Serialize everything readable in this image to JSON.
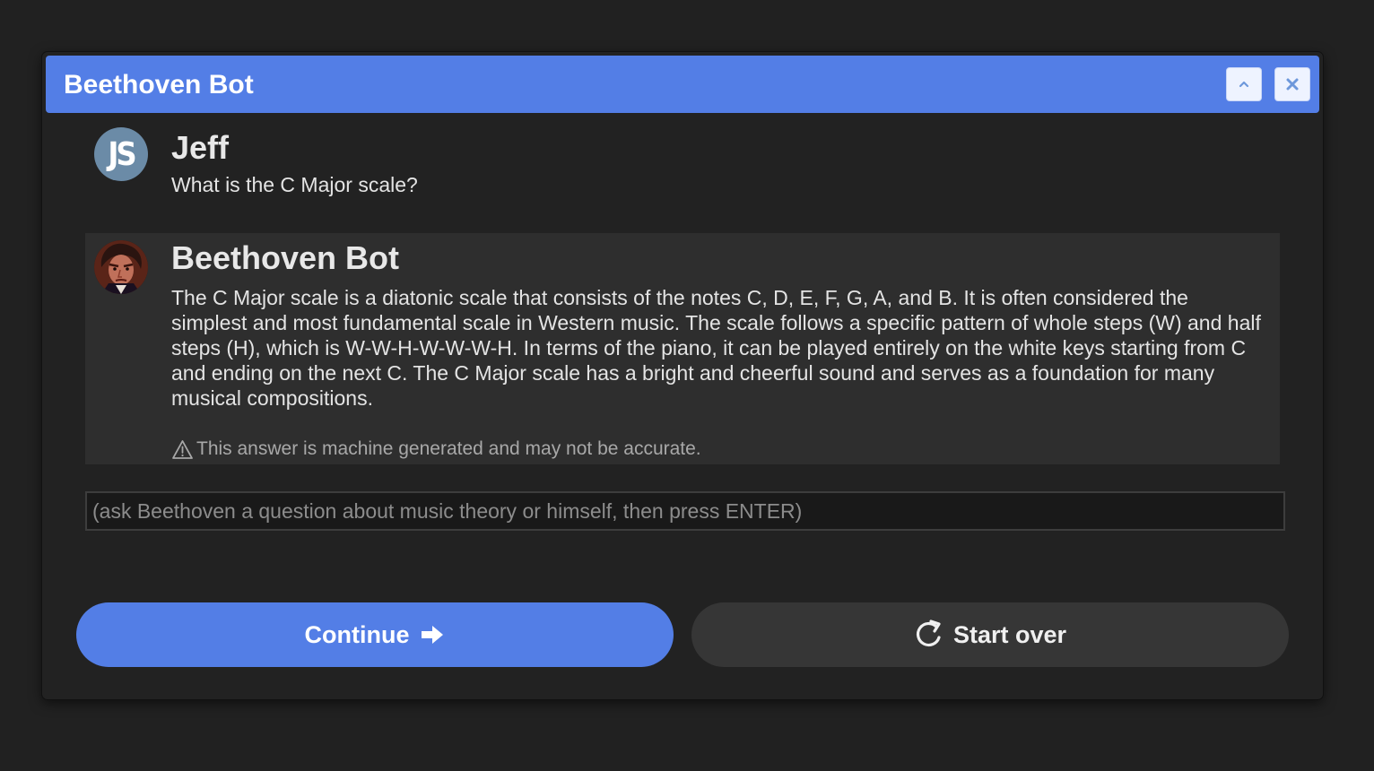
{
  "window": {
    "title": "Beethoven Bot",
    "collapse_icon": "chevron-up-icon",
    "close_icon": "close-icon"
  },
  "messages": [
    {
      "sender": "Jeff",
      "avatar_text": "JS",
      "text": "What is the C Major scale?"
    },
    {
      "sender": "Beethoven Bot",
      "avatar": "beethoven-portrait",
      "text": "The C Major scale is a diatonic scale that consists of the notes C, D, E, F, G, A, and B. It is often considered the simplest and most fundamental scale in Western music. The scale follows a specific pattern of whole steps (W) and half steps (H), which is W-W-H-W-W-W-H. In terms of the piano, it can be played entirely on the white keys starting from C and ending on the next C. The C Major scale has a bright and cheerful sound and serves as a foundation for many musical compositions.",
      "disclaimer": "This answer is machine generated and may not be accurate."
    }
  ],
  "input": {
    "placeholder": "(ask Beethoven a question about music theory or himself, then press ENTER)",
    "value": ""
  },
  "actions": {
    "continue_label": "Continue",
    "continue_icon": "arrow-right-icon",
    "start_over_label": "Start over",
    "start_over_icon": "refresh-icon"
  },
  "colors": {
    "accent": "#537ee6",
    "background": "#222222",
    "bot_message_bg": "#2e2e2e"
  }
}
